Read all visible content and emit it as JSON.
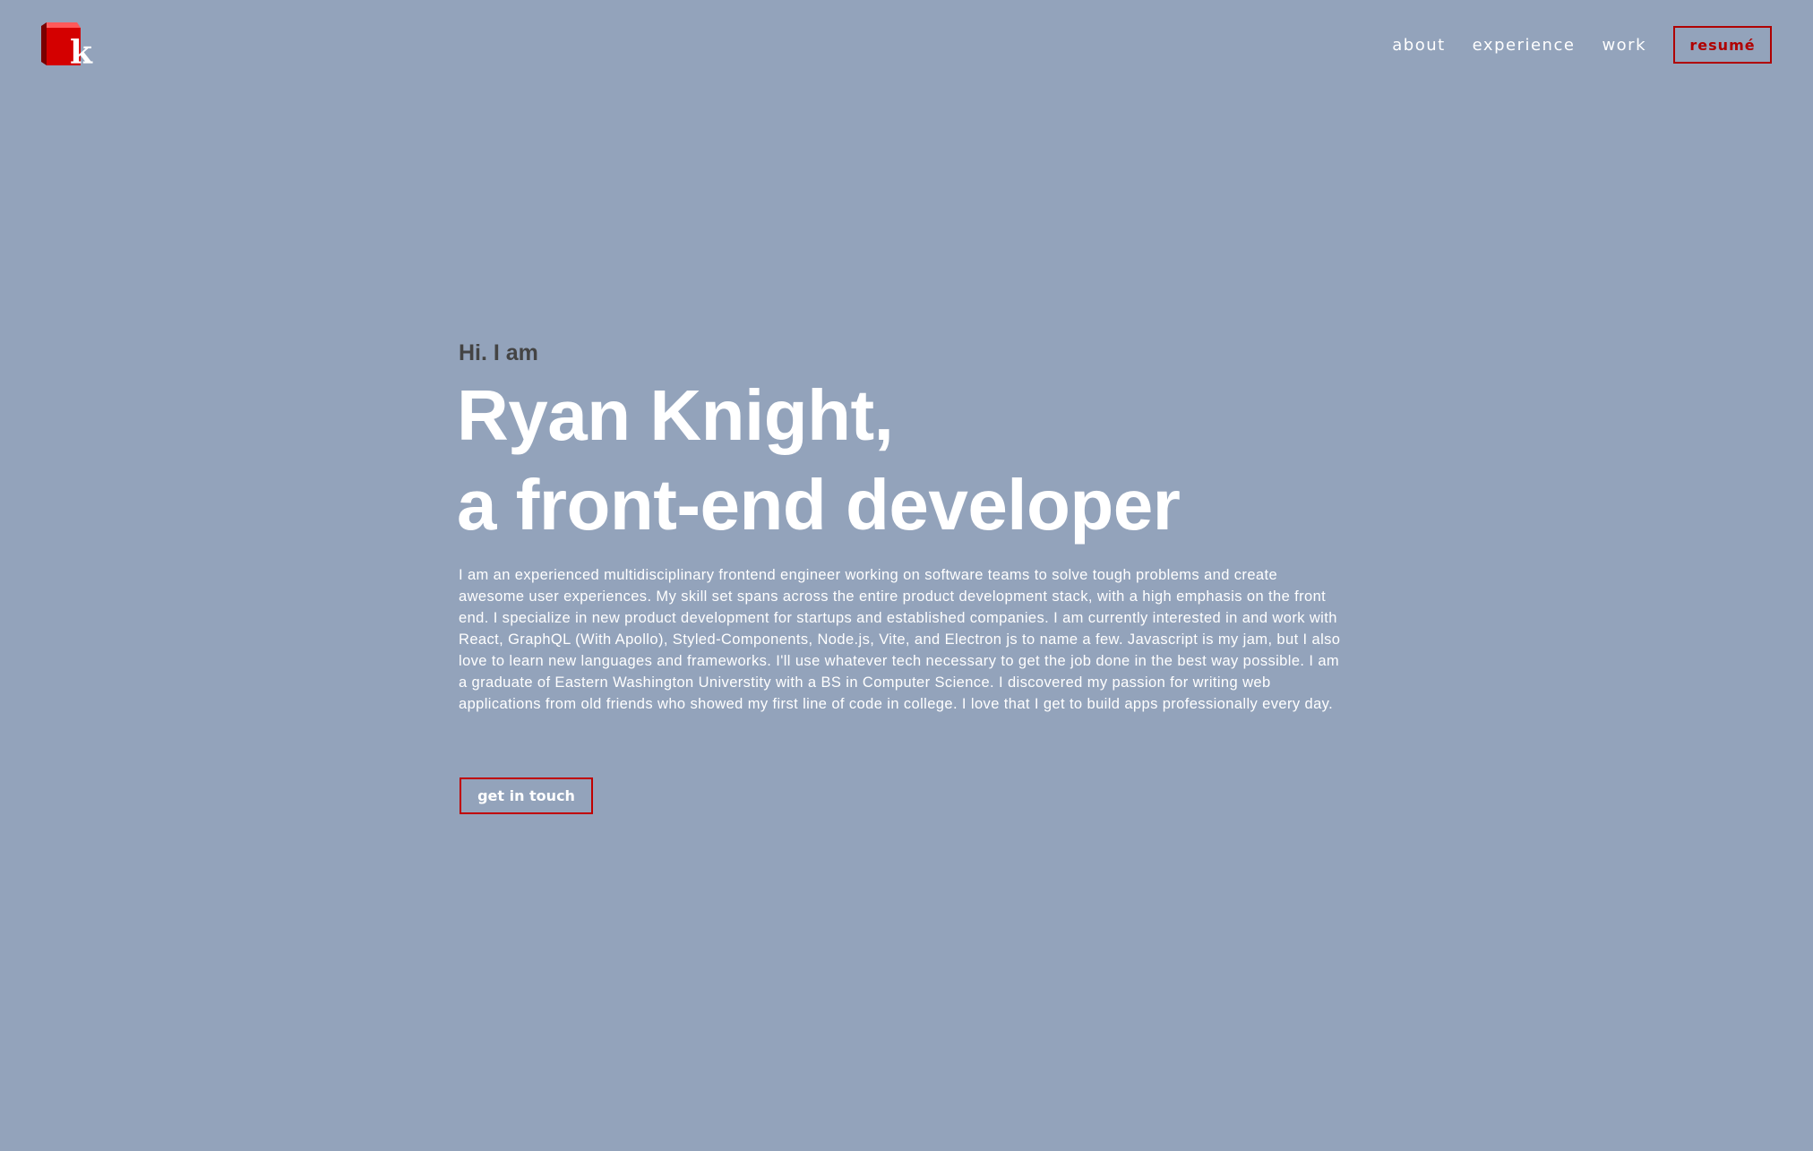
{
  "logo": {
    "letter": "k",
    "color": "#d40000"
  },
  "nav": {
    "items": [
      {
        "label": "about"
      },
      {
        "label": "experience"
      },
      {
        "label": "work"
      }
    ],
    "resume_label": "resumé"
  },
  "hero": {
    "greeting": "Hi. I am",
    "name_line": "Ryan Knight,",
    "role_line": "a front-end developer",
    "bio": "I am an experienced multidisciplinary frontend engineer working on software teams to solve tough problems and create awesome user experiences. My skill set spans across the entire product development stack, with a high emphasis on the front end. I specialize in new product development for startups and established companies. I am currently interested in and work with React, GraphQL (With Apollo), Styled-Components, Node.js, Vite, and Electron js to name a few. Javascript is my jam, but I also love to learn new languages and frameworks. I'll use whatever tech necessary to get the job done in the best way possible. I am a graduate of Eastern Washington Universtity with a BS in Computer Science. I discovered my passion for writing web applications from old friends who showed my first line of code in college. I love that I get to build apps professionally every day.",
    "cta_label": "get in touch"
  }
}
